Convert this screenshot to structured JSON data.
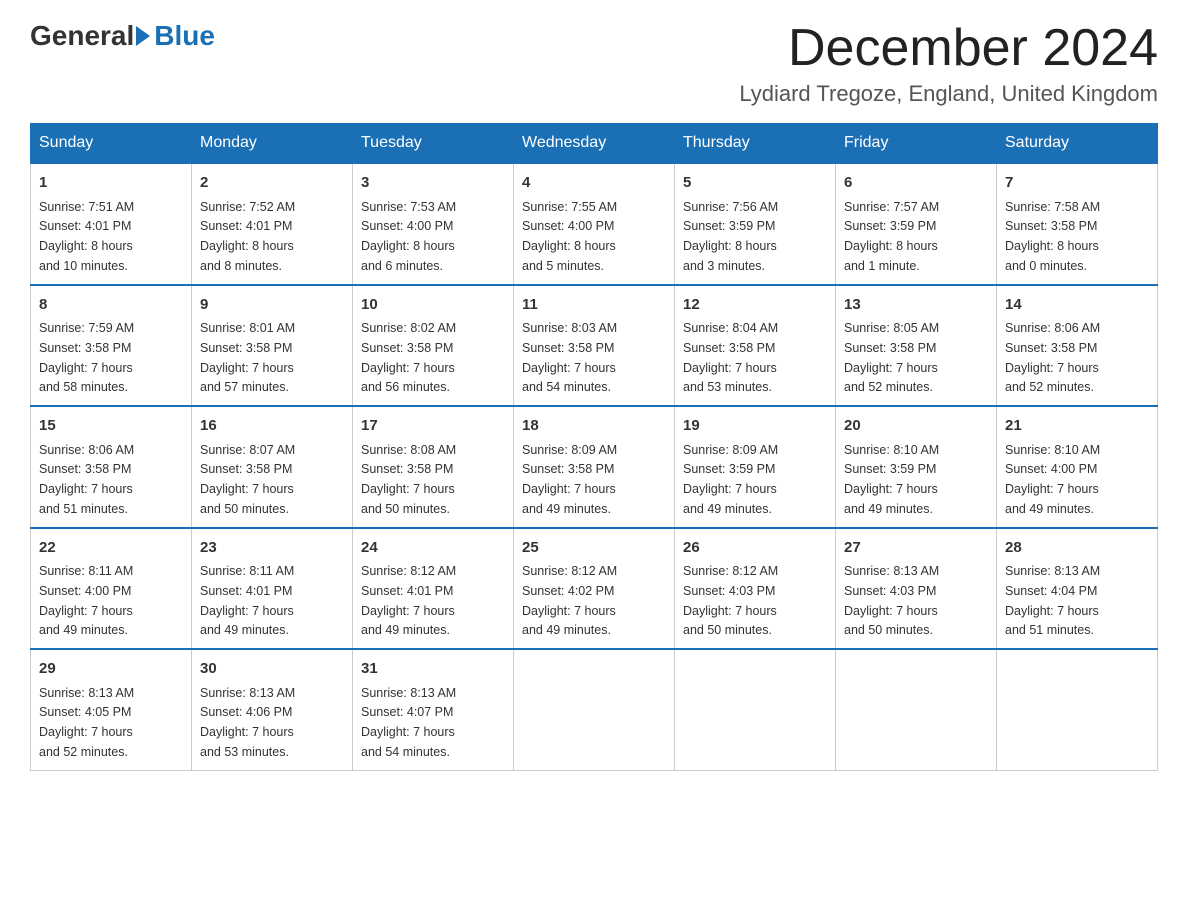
{
  "header": {
    "logo": {
      "general": "General",
      "blue": "Blue",
      "arrow": "▶"
    },
    "title": "December 2024",
    "location": "Lydiard Tregoze, England, United Kingdom"
  },
  "weekdays": [
    "Sunday",
    "Monday",
    "Tuesday",
    "Wednesday",
    "Thursday",
    "Friday",
    "Saturday"
  ],
  "weeks": [
    [
      {
        "day": "1",
        "info": "Sunrise: 7:51 AM\nSunset: 4:01 PM\nDaylight: 8 hours\nand 10 minutes."
      },
      {
        "day": "2",
        "info": "Sunrise: 7:52 AM\nSunset: 4:01 PM\nDaylight: 8 hours\nand 8 minutes."
      },
      {
        "day": "3",
        "info": "Sunrise: 7:53 AM\nSunset: 4:00 PM\nDaylight: 8 hours\nand 6 minutes."
      },
      {
        "day": "4",
        "info": "Sunrise: 7:55 AM\nSunset: 4:00 PM\nDaylight: 8 hours\nand 5 minutes."
      },
      {
        "day": "5",
        "info": "Sunrise: 7:56 AM\nSunset: 3:59 PM\nDaylight: 8 hours\nand 3 minutes."
      },
      {
        "day": "6",
        "info": "Sunrise: 7:57 AM\nSunset: 3:59 PM\nDaylight: 8 hours\nand 1 minute."
      },
      {
        "day": "7",
        "info": "Sunrise: 7:58 AM\nSunset: 3:58 PM\nDaylight: 8 hours\nand 0 minutes."
      }
    ],
    [
      {
        "day": "8",
        "info": "Sunrise: 7:59 AM\nSunset: 3:58 PM\nDaylight: 7 hours\nand 58 minutes."
      },
      {
        "day": "9",
        "info": "Sunrise: 8:01 AM\nSunset: 3:58 PM\nDaylight: 7 hours\nand 57 minutes."
      },
      {
        "day": "10",
        "info": "Sunrise: 8:02 AM\nSunset: 3:58 PM\nDaylight: 7 hours\nand 56 minutes."
      },
      {
        "day": "11",
        "info": "Sunrise: 8:03 AM\nSunset: 3:58 PM\nDaylight: 7 hours\nand 54 minutes."
      },
      {
        "day": "12",
        "info": "Sunrise: 8:04 AM\nSunset: 3:58 PM\nDaylight: 7 hours\nand 53 minutes."
      },
      {
        "day": "13",
        "info": "Sunrise: 8:05 AM\nSunset: 3:58 PM\nDaylight: 7 hours\nand 52 minutes."
      },
      {
        "day": "14",
        "info": "Sunrise: 8:06 AM\nSunset: 3:58 PM\nDaylight: 7 hours\nand 52 minutes."
      }
    ],
    [
      {
        "day": "15",
        "info": "Sunrise: 8:06 AM\nSunset: 3:58 PM\nDaylight: 7 hours\nand 51 minutes."
      },
      {
        "day": "16",
        "info": "Sunrise: 8:07 AM\nSunset: 3:58 PM\nDaylight: 7 hours\nand 50 minutes."
      },
      {
        "day": "17",
        "info": "Sunrise: 8:08 AM\nSunset: 3:58 PM\nDaylight: 7 hours\nand 50 minutes."
      },
      {
        "day": "18",
        "info": "Sunrise: 8:09 AM\nSunset: 3:58 PM\nDaylight: 7 hours\nand 49 minutes."
      },
      {
        "day": "19",
        "info": "Sunrise: 8:09 AM\nSunset: 3:59 PM\nDaylight: 7 hours\nand 49 minutes."
      },
      {
        "day": "20",
        "info": "Sunrise: 8:10 AM\nSunset: 3:59 PM\nDaylight: 7 hours\nand 49 minutes."
      },
      {
        "day": "21",
        "info": "Sunrise: 8:10 AM\nSunset: 4:00 PM\nDaylight: 7 hours\nand 49 minutes."
      }
    ],
    [
      {
        "day": "22",
        "info": "Sunrise: 8:11 AM\nSunset: 4:00 PM\nDaylight: 7 hours\nand 49 minutes."
      },
      {
        "day": "23",
        "info": "Sunrise: 8:11 AM\nSunset: 4:01 PM\nDaylight: 7 hours\nand 49 minutes."
      },
      {
        "day": "24",
        "info": "Sunrise: 8:12 AM\nSunset: 4:01 PM\nDaylight: 7 hours\nand 49 minutes."
      },
      {
        "day": "25",
        "info": "Sunrise: 8:12 AM\nSunset: 4:02 PM\nDaylight: 7 hours\nand 49 minutes."
      },
      {
        "day": "26",
        "info": "Sunrise: 8:12 AM\nSunset: 4:03 PM\nDaylight: 7 hours\nand 50 minutes."
      },
      {
        "day": "27",
        "info": "Sunrise: 8:13 AM\nSunset: 4:03 PM\nDaylight: 7 hours\nand 50 minutes."
      },
      {
        "day": "28",
        "info": "Sunrise: 8:13 AM\nSunset: 4:04 PM\nDaylight: 7 hours\nand 51 minutes."
      }
    ],
    [
      {
        "day": "29",
        "info": "Sunrise: 8:13 AM\nSunset: 4:05 PM\nDaylight: 7 hours\nand 52 minutes."
      },
      {
        "day": "30",
        "info": "Sunrise: 8:13 AM\nSunset: 4:06 PM\nDaylight: 7 hours\nand 53 minutes."
      },
      {
        "day": "31",
        "info": "Sunrise: 8:13 AM\nSunset: 4:07 PM\nDaylight: 7 hours\nand 54 minutes."
      },
      {
        "day": "",
        "info": ""
      },
      {
        "day": "",
        "info": ""
      },
      {
        "day": "",
        "info": ""
      },
      {
        "day": "",
        "info": ""
      }
    ]
  ]
}
